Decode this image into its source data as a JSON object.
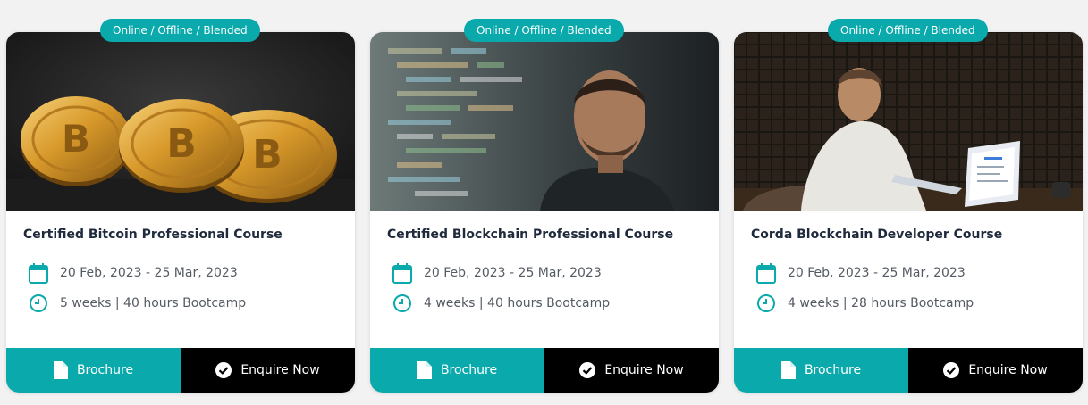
{
  "colors": {
    "accent": "#0aa9ac",
    "dark": "#000000",
    "title": "#1f2a3c",
    "text": "#555b63"
  },
  "courses": [
    {
      "badge": "Online / Offline / Blended",
      "image": "bitcoin-coins",
      "title": "Certified Bitcoin Professional Course",
      "dates": "20 Feb, 2023 - 25 Mar, 2023",
      "duration": "5 weeks | 40 hours Bootcamp",
      "brochure_label": "Brochure",
      "enquire_label": "Enquire Now"
    },
    {
      "badge": "Online / Offline / Blended",
      "image": "developer-code-screen",
      "title": "Certified Blockchain Professional Course",
      "dates": "20 Feb, 2023 - 25 Mar, 2023",
      "duration": "4 weeks | 40 hours Bootcamp",
      "brochure_label": "Brochure",
      "enquire_label": "Enquire Now"
    },
    {
      "badge": "Online / Offline / Blended",
      "image": "man-working-laptop",
      "title": "Corda Blockchain Developer Course",
      "dates": "20 Feb, 2023 - 25 Mar, 2023",
      "duration": "4 weeks | 28 hours Bootcamp",
      "brochure_label": "Brochure",
      "enquire_label": "Enquire Now"
    }
  ]
}
